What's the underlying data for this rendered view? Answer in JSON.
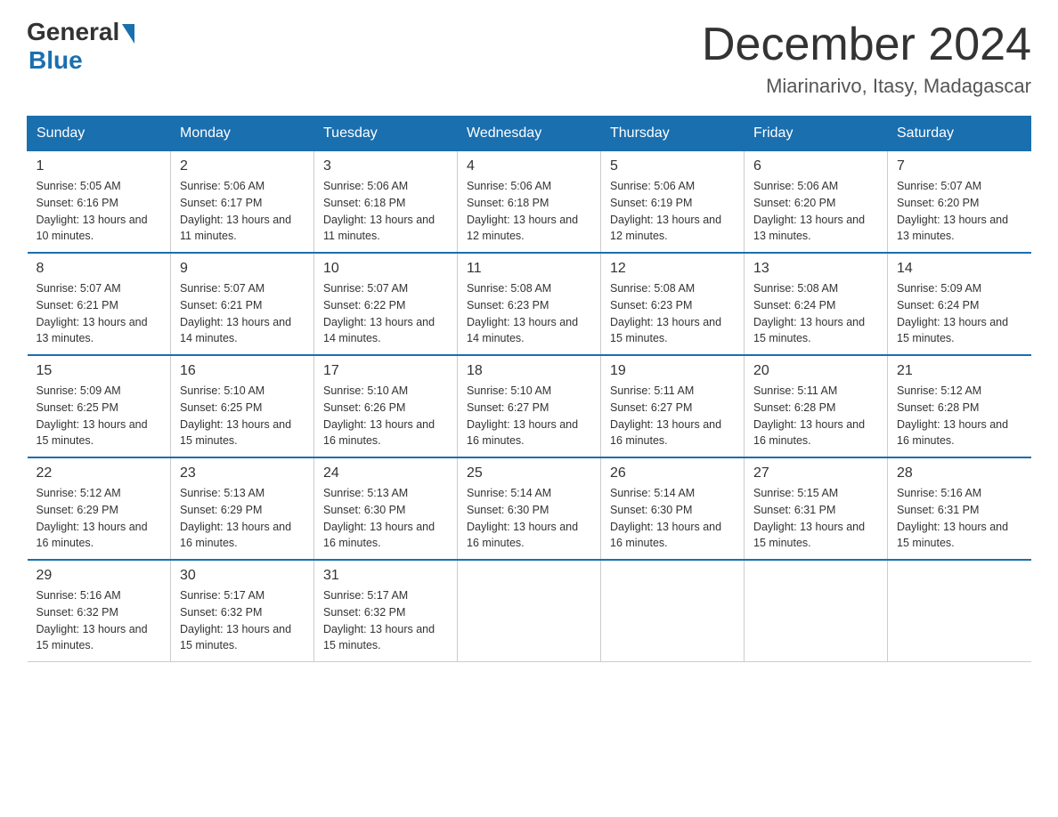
{
  "header": {
    "logo_general": "General",
    "logo_blue": "Blue",
    "title": "December 2024",
    "subtitle": "Miarinarivo, Itasy, Madagascar"
  },
  "days_of_week": [
    "Sunday",
    "Monday",
    "Tuesday",
    "Wednesday",
    "Thursday",
    "Friday",
    "Saturday"
  ],
  "weeks": [
    [
      {
        "day": "1",
        "sunrise": "5:05 AM",
        "sunset": "6:16 PM",
        "daylight": "13 hours and 10 minutes."
      },
      {
        "day": "2",
        "sunrise": "5:06 AM",
        "sunset": "6:17 PM",
        "daylight": "13 hours and 11 minutes."
      },
      {
        "day": "3",
        "sunrise": "5:06 AM",
        "sunset": "6:18 PM",
        "daylight": "13 hours and 11 minutes."
      },
      {
        "day": "4",
        "sunrise": "5:06 AM",
        "sunset": "6:18 PM",
        "daylight": "13 hours and 12 minutes."
      },
      {
        "day": "5",
        "sunrise": "5:06 AM",
        "sunset": "6:19 PM",
        "daylight": "13 hours and 12 minutes."
      },
      {
        "day": "6",
        "sunrise": "5:06 AM",
        "sunset": "6:20 PM",
        "daylight": "13 hours and 13 minutes."
      },
      {
        "day": "7",
        "sunrise": "5:07 AM",
        "sunset": "6:20 PM",
        "daylight": "13 hours and 13 minutes."
      }
    ],
    [
      {
        "day": "8",
        "sunrise": "5:07 AM",
        "sunset": "6:21 PM",
        "daylight": "13 hours and 13 minutes."
      },
      {
        "day": "9",
        "sunrise": "5:07 AM",
        "sunset": "6:21 PM",
        "daylight": "13 hours and 14 minutes."
      },
      {
        "day": "10",
        "sunrise": "5:07 AM",
        "sunset": "6:22 PM",
        "daylight": "13 hours and 14 minutes."
      },
      {
        "day": "11",
        "sunrise": "5:08 AM",
        "sunset": "6:23 PM",
        "daylight": "13 hours and 14 minutes."
      },
      {
        "day": "12",
        "sunrise": "5:08 AM",
        "sunset": "6:23 PM",
        "daylight": "13 hours and 15 minutes."
      },
      {
        "day": "13",
        "sunrise": "5:08 AM",
        "sunset": "6:24 PM",
        "daylight": "13 hours and 15 minutes."
      },
      {
        "day": "14",
        "sunrise": "5:09 AM",
        "sunset": "6:24 PM",
        "daylight": "13 hours and 15 minutes."
      }
    ],
    [
      {
        "day": "15",
        "sunrise": "5:09 AM",
        "sunset": "6:25 PM",
        "daylight": "13 hours and 15 minutes."
      },
      {
        "day": "16",
        "sunrise": "5:10 AM",
        "sunset": "6:25 PM",
        "daylight": "13 hours and 15 minutes."
      },
      {
        "day": "17",
        "sunrise": "5:10 AM",
        "sunset": "6:26 PM",
        "daylight": "13 hours and 16 minutes."
      },
      {
        "day": "18",
        "sunrise": "5:10 AM",
        "sunset": "6:27 PM",
        "daylight": "13 hours and 16 minutes."
      },
      {
        "day": "19",
        "sunrise": "5:11 AM",
        "sunset": "6:27 PM",
        "daylight": "13 hours and 16 minutes."
      },
      {
        "day": "20",
        "sunrise": "5:11 AM",
        "sunset": "6:28 PM",
        "daylight": "13 hours and 16 minutes."
      },
      {
        "day": "21",
        "sunrise": "5:12 AM",
        "sunset": "6:28 PM",
        "daylight": "13 hours and 16 minutes."
      }
    ],
    [
      {
        "day": "22",
        "sunrise": "5:12 AM",
        "sunset": "6:29 PM",
        "daylight": "13 hours and 16 minutes."
      },
      {
        "day": "23",
        "sunrise": "5:13 AM",
        "sunset": "6:29 PM",
        "daylight": "13 hours and 16 minutes."
      },
      {
        "day": "24",
        "sunrise": "5:13 AM",
        "sunset": "6:30 PM",
        "daylight": "13 hours and 16 minutes."
      },
      {
        "day": "25",
        "sunrise": "5:14 AM",
        "sunset": "6:30 PM",
        "daylight": "13 hours and 16 minutes."
      },
      {
        "day": "26",
        "sunrise": "5:14 AM",
        "sunset": "6:30 PM",
        "daylight": "13 hours and 16 minutes."
      },
      {
        "day": "27",
        "sunrise": "5:15 AM",
        "sunset": "6:31 PM",
        "daylight": "13 hours and 15 minutes."
      },
      {
        "day": "28",
        "sunrise": "5:16 AM",
        "sunset": "6:31 PM",
        "daylight": "13 hours and 15 minutes."
      }
    ],
    [
      {
        "day": "29",
        "sunrise": "5:16 AM",
        "sunset": "6:32 PM",
        "daylight": "13 hours and 15 minutes."
      },
      {
        "day": "30",
        "sunrise": "5:17 AM",
        "sunset": "6:32 PM",
        "daylight": "13 hours and 15 minutes."
      },
      {
        "day": "31",
        "sunrise": "5:17 AM",
        "sunset": "6:32 PM",
        "daylight": "13 hours and 15 minutes."
      },
      null,
      null,
      null,
      null
    ]
  ]
}
